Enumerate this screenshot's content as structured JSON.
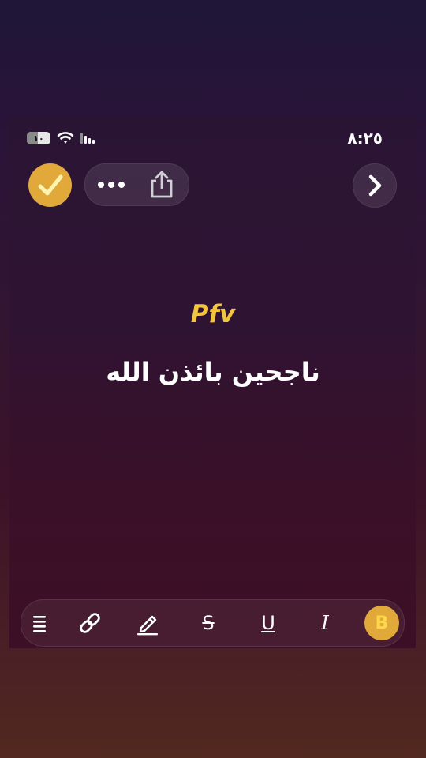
{
  "status_bar": {
    "time": "٨:٢٥",
    "battery_level": "١٠",
    "icons": [
      "battery-icon",
      "wifi-icon",
      "signal-icon"
    ]
  },
  "header": {
    "done_icon": "checkmark-icon",
    "more_icon": "ellipsis-icon",
    "share_icon": "share-icon",
    "next_icon": "chevron-right-icon"
  },
  "content": {
    "title": "Pfv",
    "text": "ناجحين بائذن الله"
  },
  "toolbar": {
    "items": [
      {
        "name": "list",
        "icon": "list-icon"
      },
      {
        "name": "link",
        "icon": "link-icon"
      },
      {
        "name": "highlight",
        "icon": "highlighter-icon"
      },
      {
        "name": "strikethrough",
        "label": "S"
      },
      {
        "name": "underline",
        "label": "U"
      },
      {
        "name": "italic",
        "label": "I"
      },
      {
        "name": "bold",
        "label": "B"
      }
    ]
  },
  "colors": {
    "accent": "#e0a93a",
    "title": "#f2c53e",
    "text": "#ffffff"
  }
}
